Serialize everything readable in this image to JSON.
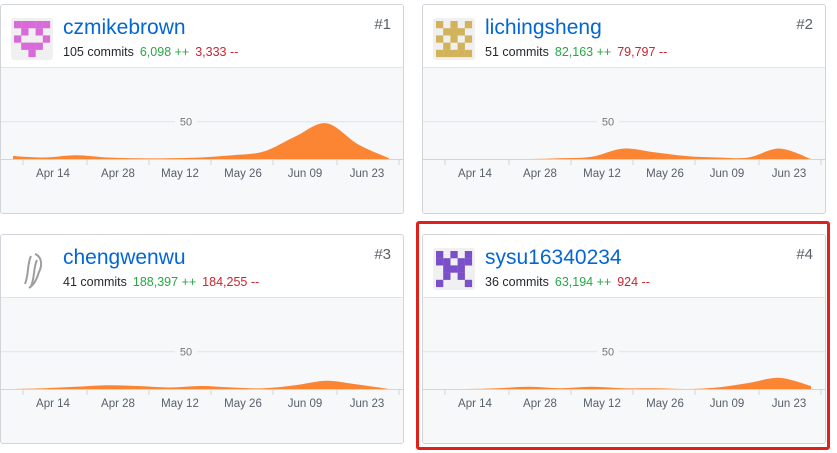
{
  "highlight_color": "#e0201b",
  "contributors": [
    {
      "username": "czmikebrown",
      "rank": "#1",
      "commits": "105 commits",
      "additions": "6,098 ++",
      "deletions": "3,333 --",
      "avatar_color": "#d96bd9",
      "avatar_icon": "identicon-icon",
      "chart_data": {
        "type": "area",
        "x_tick_labels": [
          "Apr 14",
          "Apr 28",
          "May 12",
          "May 26",
          "Jun 09",
          "Jun 23"
        ],
        "y_tick_labels": [
          "50"
        ],
        "ylim": [
          0,
          110
        ],
        "color": "#fb8532",
        "values": [
          4,
          2,
          5,
          2,
          1,
          1,
          2,
          5,
          10,
          30,
          48,
          20,
          1
        ]
      }
    },
    {
      "username": "lichingsheng",
      "rank": "#2",
      "commits": "51 commits",
      "additions": "82,163 ++",
      "deletions": "79,797 --",
      "avatar_color": "#d1b35c",
      "avatar_icon": "identicon-icon",
      "chart_data": {
        "type": "area",
        "x_tick_labels": [
          "Apr 14",
          "Apr 28",
          "May 12",
          "May 26",
          "Jun 09",
          "Jun 23"
        ],
        "y_tick_labels": [
          "50"
        ],
        "ylim": [
          0,
          110
        ],
        "color": "#fb8532",
        "values": [
          0,
          0,
          0,
          0,
          1,
          3,
          14,
          9,
          4,
          2,
          2,
          14,
          0
        ]
      }
    },
    {
      "username": "chengwenwu",
      "rank": "#3",
      "commits": "41 commits",
      "additions": "188,397 ++",
      "deletions": "184,255 --",
      "avatar_color": "#9e9e9e",
      "avatar_icon": "sketch-avatar-icon",
      "chart_data": {
        "type": "area",
        "x_tick_labels": [
          "Apr 14",
          "Apr 28",
          "May 12",
          "May 26",
          "Jun 09",
          "Jun 23"
        ],
        "y_tick_labels": [
          "50"
        ],
        "ylim": [
          0,
          110
        ],
        "color": "#fb8532",
        "values": [
          0,
          1,
          3,
          5,
          4,
          2,
          4,
          2,
          1,
          5,
          11,
          6,
          0
        ]
      }
    },
    {
      "username": "sysu16340234",
      "rank": "#4",
      "commits": "36 commits",
      "additions": "63,194 ++",
      "deletions": "924 --",
      "avatar_color": "#7b4fc9",
      "avatar_icon": "identicon-icon",
      "chart_data": {
        "type": "area",
        "x_tick_labels": [
          "Apr 14",
          "Apr 28",
          "May 12",
          "May 26",
          "Jun 09",
          "Jun 23"
        ],
        "y_tick_labels": [
          "50"
        ],
        "ylim": [
          0,
          110
        ],
        "color": "#fb8532",
        "values": [
          0,
          0,
          1,
          3,
          1,
          3,
          1,
          1,
          0,
          2,
          8,
          15,
          4
        ]
      }
    }
  ]
}
